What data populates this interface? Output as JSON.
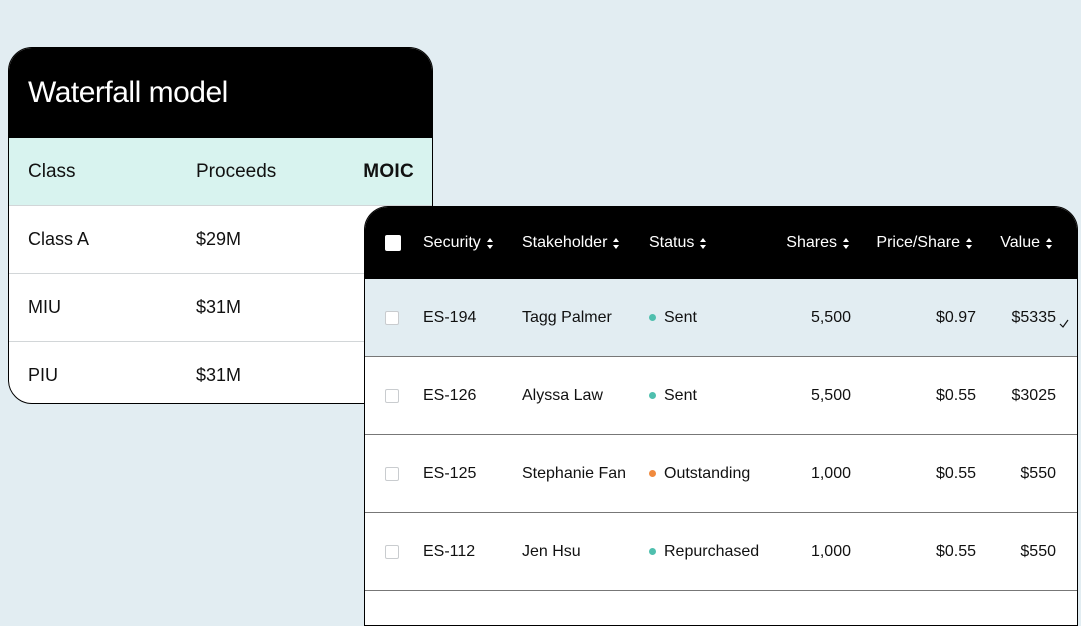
{
  "waterfall": {
    "title": "Waterfall model",
    "columns": [
      "Class",
      "Proceeds",
      "MOIC"
    ],
    "rows": [
      {
        "class": "Class A",
        "proceeds": "$29M"
      },
      {
        "class": "MIU",
        "proceeds": "$31M"
      },
      {
        "class": "PIU",
        "proceeds": "$31M"
      }
    ]
  },
  "securities": {
    "columns": [
      "Security",
      "Stakeholder",
      "Status",
      "Shares",
      "Price/Share",
      "Value"
    ],
    "rows": [
      {
        "security": "ES-194",
        "stakeholder": "Tagg Palmer",
        "status": "Sent",
        "status_color": "#4fbfae",
        "shares": "5,500",
        "price": "$0.97",
        "value": "$5335",
        "selected": true
      },
      {
        "security": "ES-126",
        "stakeholder": "Alyssa Law",
        "status": "Sent",
        "status_color": "#4fbfae",
        "shares": "5,500",
        "price": "$0.55",
        "value": "$3025",
        "selected": false
      },
      {
        "security": "ES-125",
        "stakeholder": "Stephanie Fan",
        "status": "Outstanding",
        "status_color": "#f08a3e",
        "shares": "1,000",
        "price": "$0.55",
        "value": "$550",
        "selected": false
      },
      {
        "security": "ES-112",
        "stakeholder": "Jen Hsu",
        "status": "Repurchased",
        "status_color": "#4fbfae",
        "shares": "1,000",
        "price": "$0.55",
        "value": "$550",
        "selected": false
      }
    ],
    "icons": {
      "sort": "sort-icon",
      "select": "check-icon"
    }
  },
  "colors": {
    "background": "#e2edf2",
    "header": "#000000",
    "waterfall_header_row": "#d8f3ef",
    "selected_row": "#e2edf2"
  }
}
